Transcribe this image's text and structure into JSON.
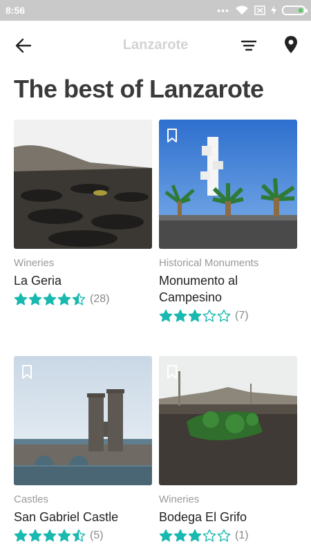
{
  "status_bar": {
    "time": "8:56",
    "dots": "•••"
  },
  "header": {
    "title": "Lanzarote"
  },
  "page_title": "The best of Lanzarote",
  "colors": {
    "accent": "#19b9b0",
    "status_bg": "#c9c9c9"
  },
  "cards": [
    {
      "category": "Wineries",
      "name": "La Geria",
      "rating": 4.5,
      "reviews": "(28)"
    },
    {
      "category": "Historical Monuments",
      "name": "Monumento al Campesino",
      "rating": 3,
      "reviews": "(7)"
    },
    {
      "category": "Castles",
      "name": "San Gabriel Castle",
      "rating": 4.5,
      "reviews": "(5)"
    },
    {
      "category": "Wineries",
      "name": "Bodega El Grifo",
      "rating": 3,
      "reviews": "(1)"
    }
  ]
}
